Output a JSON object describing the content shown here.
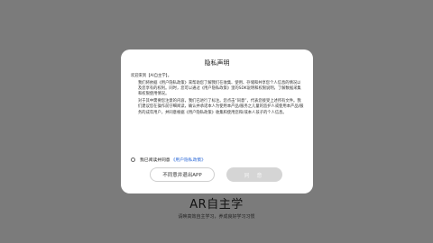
{
  "app": {
    "title": "AR自主学",
    "slogan": "请唤高效自主学习，养成良好学习习惯"
  },
  "dialog": {
    "title": "隐私声明",
    "greeting": "欢迎来到【AI自主学】。",
    "para1": "我们将依据《用户隐私政策》来帮助您了解我们在收集、使用、存储和共享您个人信息的情况以及您享有的权利。同时，您可以通过《用户隐私政策》里的SDK说明和权限说明，了解数据采集和权限使用情况。",
    "para2": "对于其中需要您注意的内容，我们已进行了标注。您点击“同意”，代表您接受上述所有文件。我们建议您在操作前仔细阅读，确认并承诺本人为使用本产品/服务之儿童的监护人或使用本产品/服务的成年用户，并同意根据《用户隐私政策》收集和使用您和/或本人孩子的个人信息。",
    "consent_prefix": "我已阅读并同意",
    "consent_link": "《用户隐私政策》",
    "disagree_button": "不同意并退出APP",
    "agree_button": "同 意"
  },
  "colors": {
    "backdrop": "#7b7b7b",
    "link": "#2e6bd8",
    "agree_button_disabled": "#d5d5d5"
  }
}
